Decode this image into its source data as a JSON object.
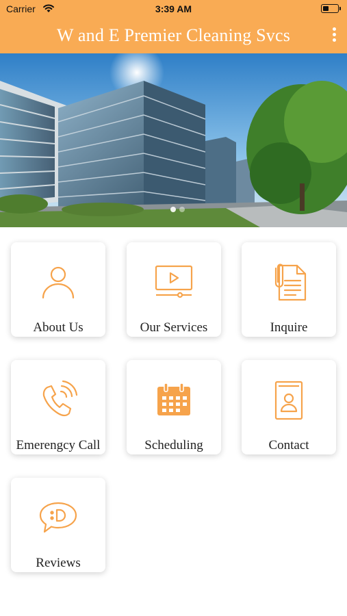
{
  "status_bar": {
    "carrier": "Carrier",
    "time": "3:39 AM"
  },
  "header": {
    "title": "W and E Premier Cleaning Svcs",
    "menu_icon": "more-vertical-icon"
  },
  "hero": {
    "image": "office-buildings-photo",
    "carousel_dots": 2,
    "active_dot": 1
  },
  "theme": {
    "accent": "#f9ab54",
    "icon_color": "#f6a34b",
    "background": "#ffffff"
  },
  "tiles": [
    {
      "label": "About Us",
      "icon": "person-icon"
    },
    {
      "label": "Our Services",
      "icon": "video-play-icon"
    },
    {
      "label": "Inquire",
      "icon": "document-clip-icon"
    },
    {
      "label": "Emerengcy Call",
      "icon": "phone-call-icon"
    },
    {
      "label": "Scheduling",
      "icon": "calendar-icon"
    },
    {
      "label": "Contact",
      "icon": "contact-book-icon"
    },
    {
      "label": "Reviews",
      "icon": "chat-bubble-icon"
    }
  ]
}
